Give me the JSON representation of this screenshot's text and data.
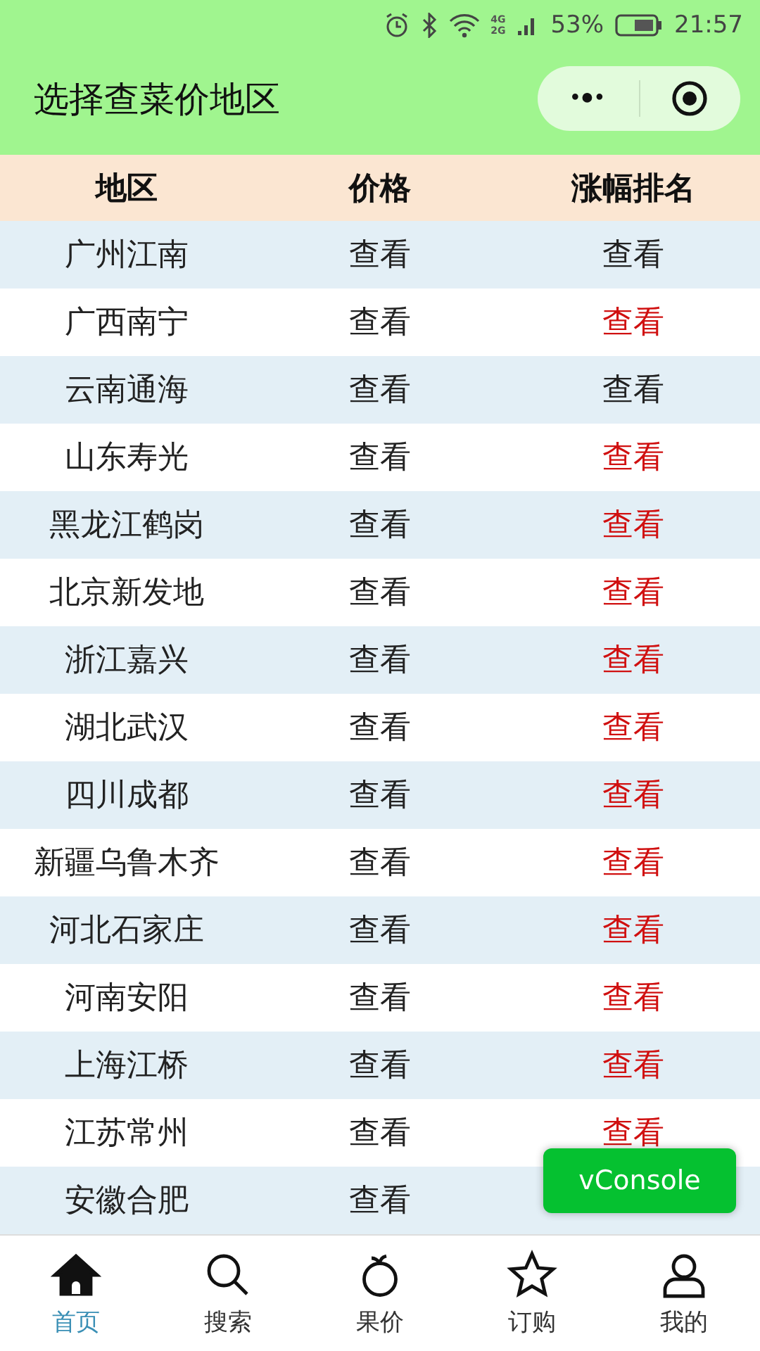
{
  "status_bar": {
    "network_top": "4G",
    "network_bottom": "2G",
    "battery": "53%",
    "time": "21:57"
  },
  "nav_bar": {
    "title": "选择查菜价地区",
    "more": "•●•"
  },
  "table": {
    "columns": [
      "地区",
      "价格",
      "涨幅排名"
    ],
    "rows": [
      {
        "region": "广州江南",
        "price": "查看",
        "rank": "查看",
        "highlighted": false
      },
      {
        "region": "广西南宁",
        "price": "查看",
        "rank": "查看",
        "highlighted": true
      },
      {
        "region": "云南通海",
        "price": "查看",
        "rank": "查看",
        "highlighted": false
      },
      {
        "region": "山东寿光",
        "price": "查看",
        "rank": "查看",
        "highlighted": true
      },
      {
        "region": "黑龙江鹤岗",
        "price": "查看",
        "rank": "查看",
        "highlighted": true
      },
      {
        "region": "北京新发地",
        "price": "查看",
        "rank": "查看",
        "highlighted": true
      },
      {
        "region": "浙江嘉兴",
        "price": "查看",
        "rank": "查看",
        "highlighted": true
      },
      {
        "region": "湖北武汉",
        "price": "查看",
        "rank": "查看",
        "highlighted": true
      },
      {
        "region": "四川成都",
        "price": "查看",
        "rank": "查看",
        "highlighted": true
      },
      {
        "region": "新疆乌鲁木齐",
        "price": "查看",
        "rank": "查看",
        "highlighted": true
      },
      {
        "region": "河北石家庄",
        "price": "查看",
        "rank": "查看",
        "highlighted": true
      },
      {
        "region": "河南安阳",
        "price": "查看",
        "rank": "查看",
        "highlighted": true
      },
      {
        "region": "上海江桥",
        "price": "查看",
        "rank": "查看",
        "highlighted": true
      },
      {
        "region": "江苏常州",
        "price": "查看",
        "rank": "查看",
        "highlighted": true
      },
      {
        "region": "安徽合肥",
        "price": "查看"
      }
    ]
  },
  "vconsole": "vConsole",
  "tab_bar": [
    {
      "label": "首页",
      "kind": "home",
      "selected": true
    },
    {
      "label": "搜索",
      "kind": "search",
      "selected": false
    },
    {
      "label": "果价",
      "kind": "apple",
      "selected": false
    },
    {
      "label": "订购",
      "kind": "star",
      "selected": false
    },
    {
      "label": "我的",
      "kind": "user",
      "selected": false
    }
  ]
}
